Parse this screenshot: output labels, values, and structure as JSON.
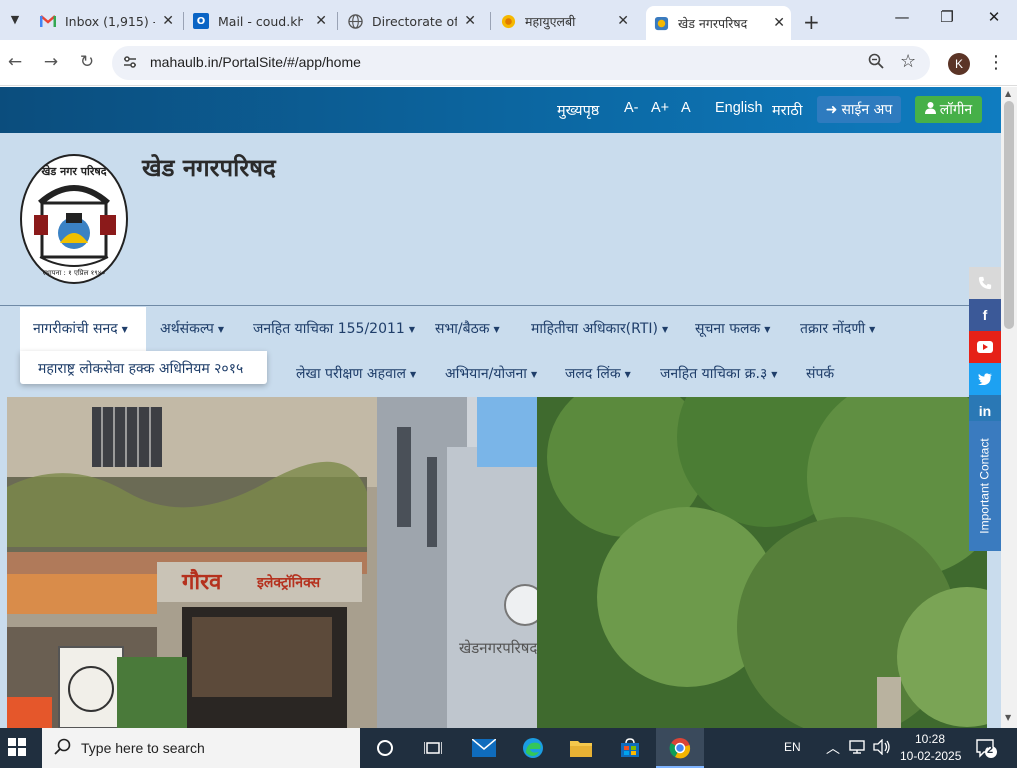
{
  "browser": {
    "tabs": [
      {
        "title": "Inbox (1,915) - ",
        "icon": "gmail-icon"
      },
      {
        "title": "Mail - coud.khe",
        "icon": "outlook-icon"
      },
      {
        "title": "Directorate of M",
        "icon": "globe-icon"
      },
      {
        "title": "महायुएलबी",
        "icon": "site-icon"
      },
      {
        "title": "खेड नगरपरिषद",
        "icon": "site-icon",
        "active": true
      }
    ],
    "url": "mahaulb.in/PortalSite/#/app/home",
    "profile_initial": "K"
  },
  "topbar": {
    "home": "मुख्यपृष्ठ",
    "font_minus": "A-",
    "font_plus": "A+",
    "font_reset": "A",
    "lang_english": "English",
    "lang_marathi": "मराठी",
    "signup": "साईन अप",
    "login": "लॉगीन"
  },
  "header": {
    "title": "खेड नगरपरिषद"
  },
  "menu": {
    "row1": [
      "नागरीकांची सनद",
      "अर्थसंकल्प",
      "जनहित याचिका 155/2011",
      "सभा/बैठक",
      "माहितीचा अधिकार(RTI)",
      "सूचना फलक",
      "तक्रार नोंदणी"
    ],
    "row2": [
      "लेखा परीक्षण अहवाल",
      "अभियान/योजना",
      "जलद लिंक",
      "जनहित याचिका क्र.३",
      "संपर्क"
    ],
    "dropdown_item": "महाराष्ट्र लोकसेवा हक्क अधिनियम २०१५"
  },
  "banner": {
    "shop_sign": "गौरव इलेक्ट्रॉनिक्स",
    "building_sign": "खेड नगरपरिषद"
  },
  "side_widget": {
    "important_contact": "Important Contact"
  },
  "taskbar": {
    "search_placeholder": "Type here to search",
    "lang": "EN",
    "time": "10:28",
    "date": "10-02-2025",
    "notification_count": "2"
  }
}
